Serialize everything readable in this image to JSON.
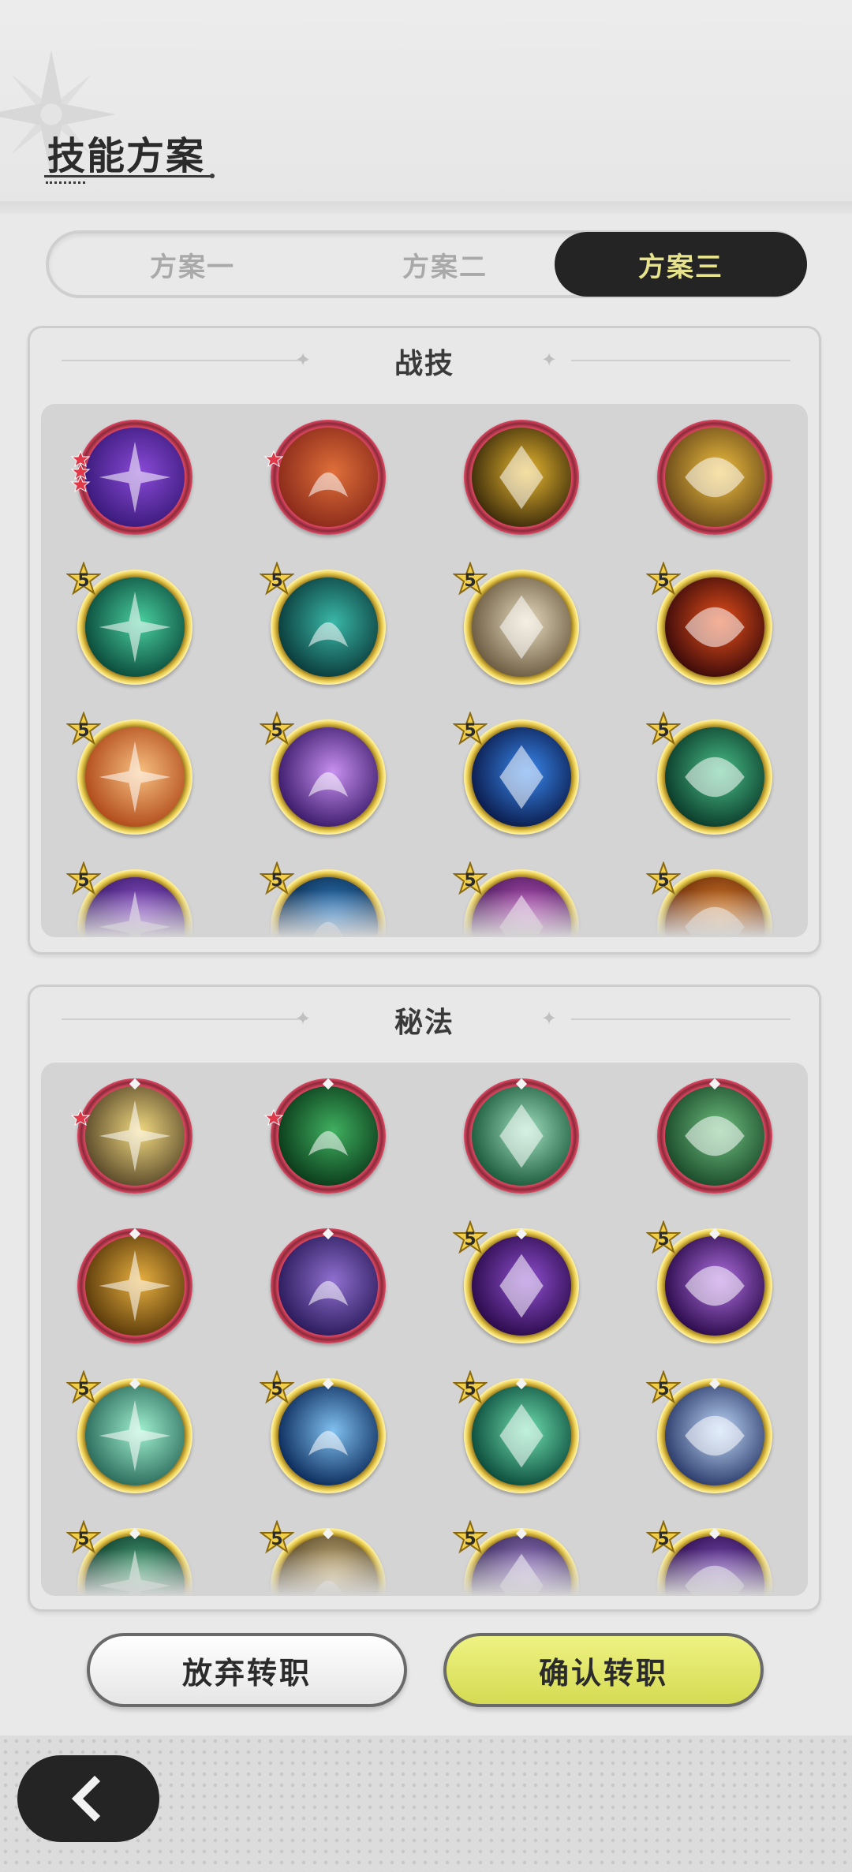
{
  "page": {
    "title": "技能方案"
  },
  "tabs": [
    {
      "label": "方案一",
      "active": false
    },
    {
      "label": "方案二",
      "active": false
    },
    {
      "label": "方案三",
      "active": true
    }
  ],
  "sections": [
    {
      "title": "战技",
      "skills": [
        {
          "icon": "void-star-icon",
          "rarity": "red",
          "red_stars": 3,
          "colors": [
            "#3a1a7a",
            "#8a4ad8"
          ]
        },
        {
          "icon": "arrow-totem-icon",
          "rarity": "red",
          "red_stars": 1,
          "colors": [
            "#8a2a1a",
            "#e0703a"
          ]
        },
        {
          "icon": "gold-crystal-icon",
          "rarity": "red",
          "red_stars": 0,
          "colors": [
            "#3a2a0a",
            "#e8b830"
          ]
        },
        {
          "icon": "stone-golem-icon",
          "rarity": "red",
          "red_stars": 0,
          "colors": [
            "#6a4a1a",
            "#f0c040"
          ]
        },
        {
          "icon": "wind-blades-icon",
          "rarity": "gold",
          "level": "5",
          "colors": [
            "#0a4a3a",
            "#4ad0a0"
          ]
        },
        {
          "icon": "vortex-icon",
          "rarity": "gold",
          "level": "5",
          "colors": [
            "#0a3a3a",
            "#3ab8a8"
          ]
        },
        {
          "icon": "rock-shards-icon",
          "rarity": "gold",
          "level": "5",
          "colors": [
            "#6a5a40",
            "#e8dcc0"
          ]
        },
        {
          "icon": "fireball-icon",
          "rarity": "gold",
          "level": "5",
          "colors": [
            "#3a0a0a",
            "#e8501a"
          ]
        },
        {
          "icon": "flame-beast-icon",
          "rarity": "gold",
          "level": "5",
          "colors": [
            "#b04a1a",
            "#f8c080"
          ]
        },
        {
          "icon": "violet-burst-icon",
          "rarity": "gold",
          "level": "5",
          "colors": [
            "#3a1a6a",
            "#c890f0"
          ]
        },
        {
          "icon": "water-wave-icon",
          "rarity": "gold",
          "level": "5",
          "colors": [
            "#0a1a4a",
            "#3a8af0"
          ]
        },
        {
          "icon": "thorn-vine-icon",
          "rarity": "gold",
          "level": "5",
          "colors": [
            "#0a3a2a",
            "#4ac088"
          ]
        },
        {
          "icon": "violet-orb-icon",
          "rarity": "gold",
          "level": "5",
          "colors": [
            "#3a1a6a",
            "#a060e0"
          ]
        },
        {
          "icon": "blue-orb-icon",
          "rarity": "gold",
          "level": "5",
          "colors": [
            "#0a2a4a",
            "#3a90e0"
          ]
        },
        {
          "icon": "pink-orb-icon",
          "rarity": "gold",
          "level": "5",
          "colors": [
            "#4a1a5a",
            "#d060d0"
          ]
        },
        {
          "icon": "ember-orb-icon",
          "rarity": "gold",
          "level": "5",
          "colors": [
            "#6a2a0a",
            "#f09030"
          ]
        }
      ]
    },
    {
      "title": "秘法",
      "skills": [
        {
          "icon": "golden-rise-icon",
          "rarity": "red",
          "red_stars": 1,
          "colors": [
            "#5a4a2a",
            "#f0d880"
          ]
        },
        {
          "icon": "green-heal-icon",
          "rarity": "red",
          "red_stars": 1,
          "colors": [
            "#0a3a1a",
            "#40b060"
          ]
        },
        {
          "icon": "green-shield-icon",
          "rarity": "red",
          "red_stars": 0,
          "colors": [
            "#1a5a3a",
            "#a0e0c0"
          ]
        },
        {
          "icon": "winged-star-icon",
          "rarity": "red",
          "red_stars": 0,
          "colors": [
            "#1a4a2a",
            "#70c080"
          ]
        },
        {
          "icon": "golden-figure-icon",
          "rarity": "red",
          "red_stars": 0,
          "colors": [
            "#5a3a0a",
            "#e8b040"
          ]
        },
        {
          "icon": "violet-figure-icon",
          "rarity": "red",
          "red_stars": 0,
          "colors": [
            "#2a1a5a",
            "#9070d0"
          ]
        },
        {
          "icon": "violet-claw-icon",
          "rarity": "gold",
          "level": "5",
          "colors": [
            "#2a0a4a",
            "#9050d0"
          ]
        },
        {
          "icon": "dark-spirit-icon",
          "rarity": "gold",
          "level": "5",
          "colors": [
            "#2a0a4a",
            "#b070e0"
          ]
        },
        {
          "icon": "jade-seal-icon",
          "rarity": "gold",
          "level": "5",
          "colors": [
            "#2a6a5a",
            "#a0f0d0"
          ]
        },
        {
          "icon": "blue-figure-icon",
          "rarity": "gold",
          "level": "5",
          "colors": [
            "#0a2a5a",
            "#80c0f0"
          ]
        },
        {
          "icon": "teal-figure-icon",
          "rarity": "gold",
          "level": "5",
          "colors": [
            "#0a4a3a",
            "#70e0b0"
          ]
        },
        {
          "icon": "crystal-spark-icon",
          "rarity": "gold",
          "level": "5",
          "colors": [
            "#2a3a6a",
            "#c0d8f8"
          ]
        },
        {
          "icon": "green-orb-icon",
          "rarity": "gold",
          "level": "5",
          "colors": [
            "#0a3a2a",
            "#60c090"
          ]
        },
        {
          "icon": "tan-orb-icon",
          "rarity": "gold",
          "level": "5",
          "colors": [
            "#5a4a2a",
            "#e0c890"
          ]
        },
        {
          "icon": "lilac-orb-icon",
          "rarity": "gold",
          "level": "5",
          "colors": [
            "#3a2a5a",
            "#b090e0"
          ]
        },
        {
          "icon": "purple-orb-icon",
          "rarity": "gold",
          "level": "5",
          "colors": [
            "#2a0a4a",
            "#9060d0"
          ]
        }
      ]
    }
  ],
  "buttons": {
    "abandon": "放弃转职",
    "confirm": "确认转职"
  },
  "theme": {
    "ring_red": "#d6445e",
    "ring_gold": "#e6c84a",
    "accent_yellow": "#e6e38a",
    "dark": "#242424"
  },
  "back_icon": "chevron-left-icon"
}
